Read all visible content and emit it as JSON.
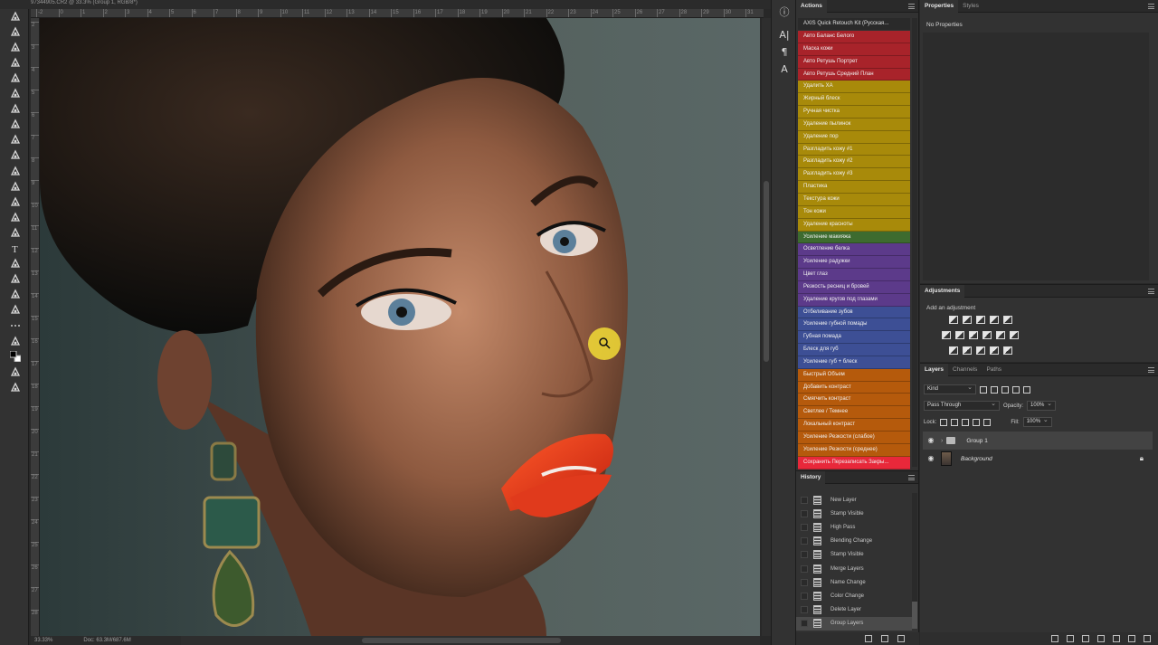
{
  "document": {
    "tab_title": "97344905.CR2 @ 33.3% (Group 1, RGB/8*)",
    "zoom": "33.33%",
    "doc_size": "Doc: 63.3M/687.6M"
  },
  "ruler": {
    "h_ticks": [
      "-2",
      "0",
      "1",
      "2",
      "3",
      "4",
      "5",
      "6",
      "7",
      "8",
      "9",
      "10",
      "11",
      "12",
      "13",
      "14",
      "15",
      "16",
      "17",
      "18",
      "19",
      "20",
      "21",
      "22",
      "23",
      "24",
      "25",
      "26",
      "27",
      "28",
      "29",
      "30",
      "31"
    ],
    "v_ticks": [
      "2",
      "3",
      "4",
      "5",
      "6",
      "7",
      "8",
      "9",
      "10",
      "11",
      "12",
      "13",
      "14",
      "15",
      "16",
      "17",
      "18",
      "19",
      "20",
      "21",
      "22",
      "23",
      "24",
      "25",
      "26",
      "27",
      "28"
    ]
  },
  "dock_icons": [
    "info-icon",
    "character-icon",
    "paragraph-icon",
    "glyphs-icon"
  ],
  "dock_glyphs": [
    "ⓘ",
    "A|",
    "¶",
    "A"
  ],
  "actions": {
    "tab": "Actions",
    "set_name": "AXIS Quick Retouch Kit (Русская...",
    "items": [
      {
        "label": "Авто Баланс Белого",
        "color": "#a8232a"
      },
      {
        "label": "Маска кожи",
        "color": "#a8232a"
      },
      {
        "label": "Авто Ретушь Портрет",
        "color": "#a8232a"
      },
      {
        "label": "Авто Ретушь Средний План",
        "color": "#a8232a"
      },
      {
        "label": "Удалить ХА",
        "color": "#a88a0a"
      },
      {
        "label": "Жирный блеск",
        "color": "#a88a0a"
      },
      {
        "label": "Ручная чистка",
        "color": "#a88a0a"
      },
      {
        "label": "Удаление пылинок",
        "color": "#a88a0a"
      },
      {
        "label": "Удаление пор",
        "color": "#a88a0a"
      },
      {
        "label": "Разгладить кожу #1",
        "color": "#a88a0a"
      },
      {
        "label": "Разгладить кожу #2",
        "color": "#a88a0a"
      },
      {
        "label": "Разгладить кожу #3",
        "color": "#a88a0a"
      },
      {
        "label": "Пластика",
        "color": "#a88a0a"
      },
      {
        "label": "Текстура кожи",
        "color": "#a88a0a"
      },
      {
        "label": "Тон кожи",
        "color": "#a88a0a"
      },
      {
        "label": "Удаление красноты",
        "color": "#a88a0a"
      },
      {
        "label": "Усиление макияжа",
        "color": "#3d6b2f"
      },
      {
        "label": "Осветление белка",
        "color": "#5c3a8a"
      },
      {
        "label": "Усиление радужки",
        "color": "#5c3a8a"
      },
      {
        "label": "Цвет глаз",
        "color": "#5c3a8a"
      },
      {
        "label": "Резкость ресниц и бровей",
        "color": "#5c3a8a"
      },
      {
        "label": "Удаление кругов под глазами",
        "color": "#5c3a8a"
      },
      {
        "label": "Отбеливание зубов",
        "color": "#3d4f95"
      },
      {
        "label": "Усиление губной помады",
        "color": "#3d4f95"
      },
      {
        "label": "Губная помада",
        "color": "#3d4f95"
      },
      {
        "label": "Блеск для губ",
        "color": "#3d4f95"
      },
      {
        "label": "Усиление губ + блеск",
        "color": "#3d4f95"
      },
      {
        "label": "Быстрый Объем",
        "color": "#b55a0c"
      },
      {
        "label": "Добавить контраст",
        "color": "#b55a0c"
      },
      {
        "label": "Смягчить контраст",
        "color": "#b55a0c"
      },
      {
        "label": "Светлее / Темнее",
        "color": "#b55a0c"
      },
      {
        "label": "Локальный контраст",
        "color": "#b55a0c"
      },
      {
        "label": "Усиление Резкости (слабое)",
        "color": "#b55a0c"
      },
      {
        "label": "Усиление Резкости (среднее)",
        "color": "#b55a0c"
      },
      {
        "label": "Сохранить Перезаписать Закры...",
        "color": "#e8283a"
      }
    ]
  },
  "history": {
    "tab": "History",
    "items": [
      "New Layer",
      "Stamp Visible",
      "High Pass",
      "Blending Change",
      "Stamp Visible",
      "Merge Layers",
      "Name Change",
      "Color Change",
      "Delete Layer",
      "Group Layers"
    ]
  },
  "properties": {
    "tabs": [
      "Properties",
      "Styles"
    ],
    "empty_text": "No Properties"
  },
  "adjustments": {
    "tab": "Adjustments",
    "subtitle": "Add an adjustment"
  },
  "layers": {
    "tabs": [
      "Layers",
      "Channels",
      "Paths"
    ],
    "filter": "Kind",
    "blend_mode": "Pass Through",
    "opacity_label": "Opacity:",
    "opacity": "100%",
    "lock_label": "Lock:",
    "fill_label": "Fill:",
    "fill": "100%",
    "items": [
      {
        "name": "Group 1",
        "type": "group"
      },
      {
        "name": "Background",
        "type": "image"
      }
    ]
  }
}
